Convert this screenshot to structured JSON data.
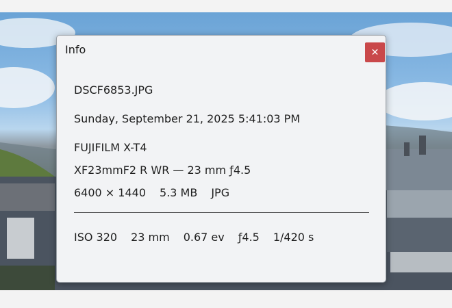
{
  "dialog": {
    "title": "Info",
    "close_icon": "close-icon"
  },
  "file": {
    "name": "DSCF6853.JPG",
    "date": "Sunday, September 21, 2025 5:41:03 PM",
    "camera": "FUJIFILM X-T4",
    "lens_line": "XF23mmF2 R WR — 23 mm ƒ4.5",
    "dimensions": "6400 × 1440",
    "size": "5.3 MB",
    "format": "JPG"
  },
  "exposure": {
    "iso": "ISO 320",
    "focal_length": "23 mm",
    "ev": "0.67 ev",
    "aperture": "ƒ4.5",
    "shutter": "1/420 s"
  },
  "colors": {
    "close_button": "#c9484a",
    "dialog_bg": "#f2f3f5"
  }
}
